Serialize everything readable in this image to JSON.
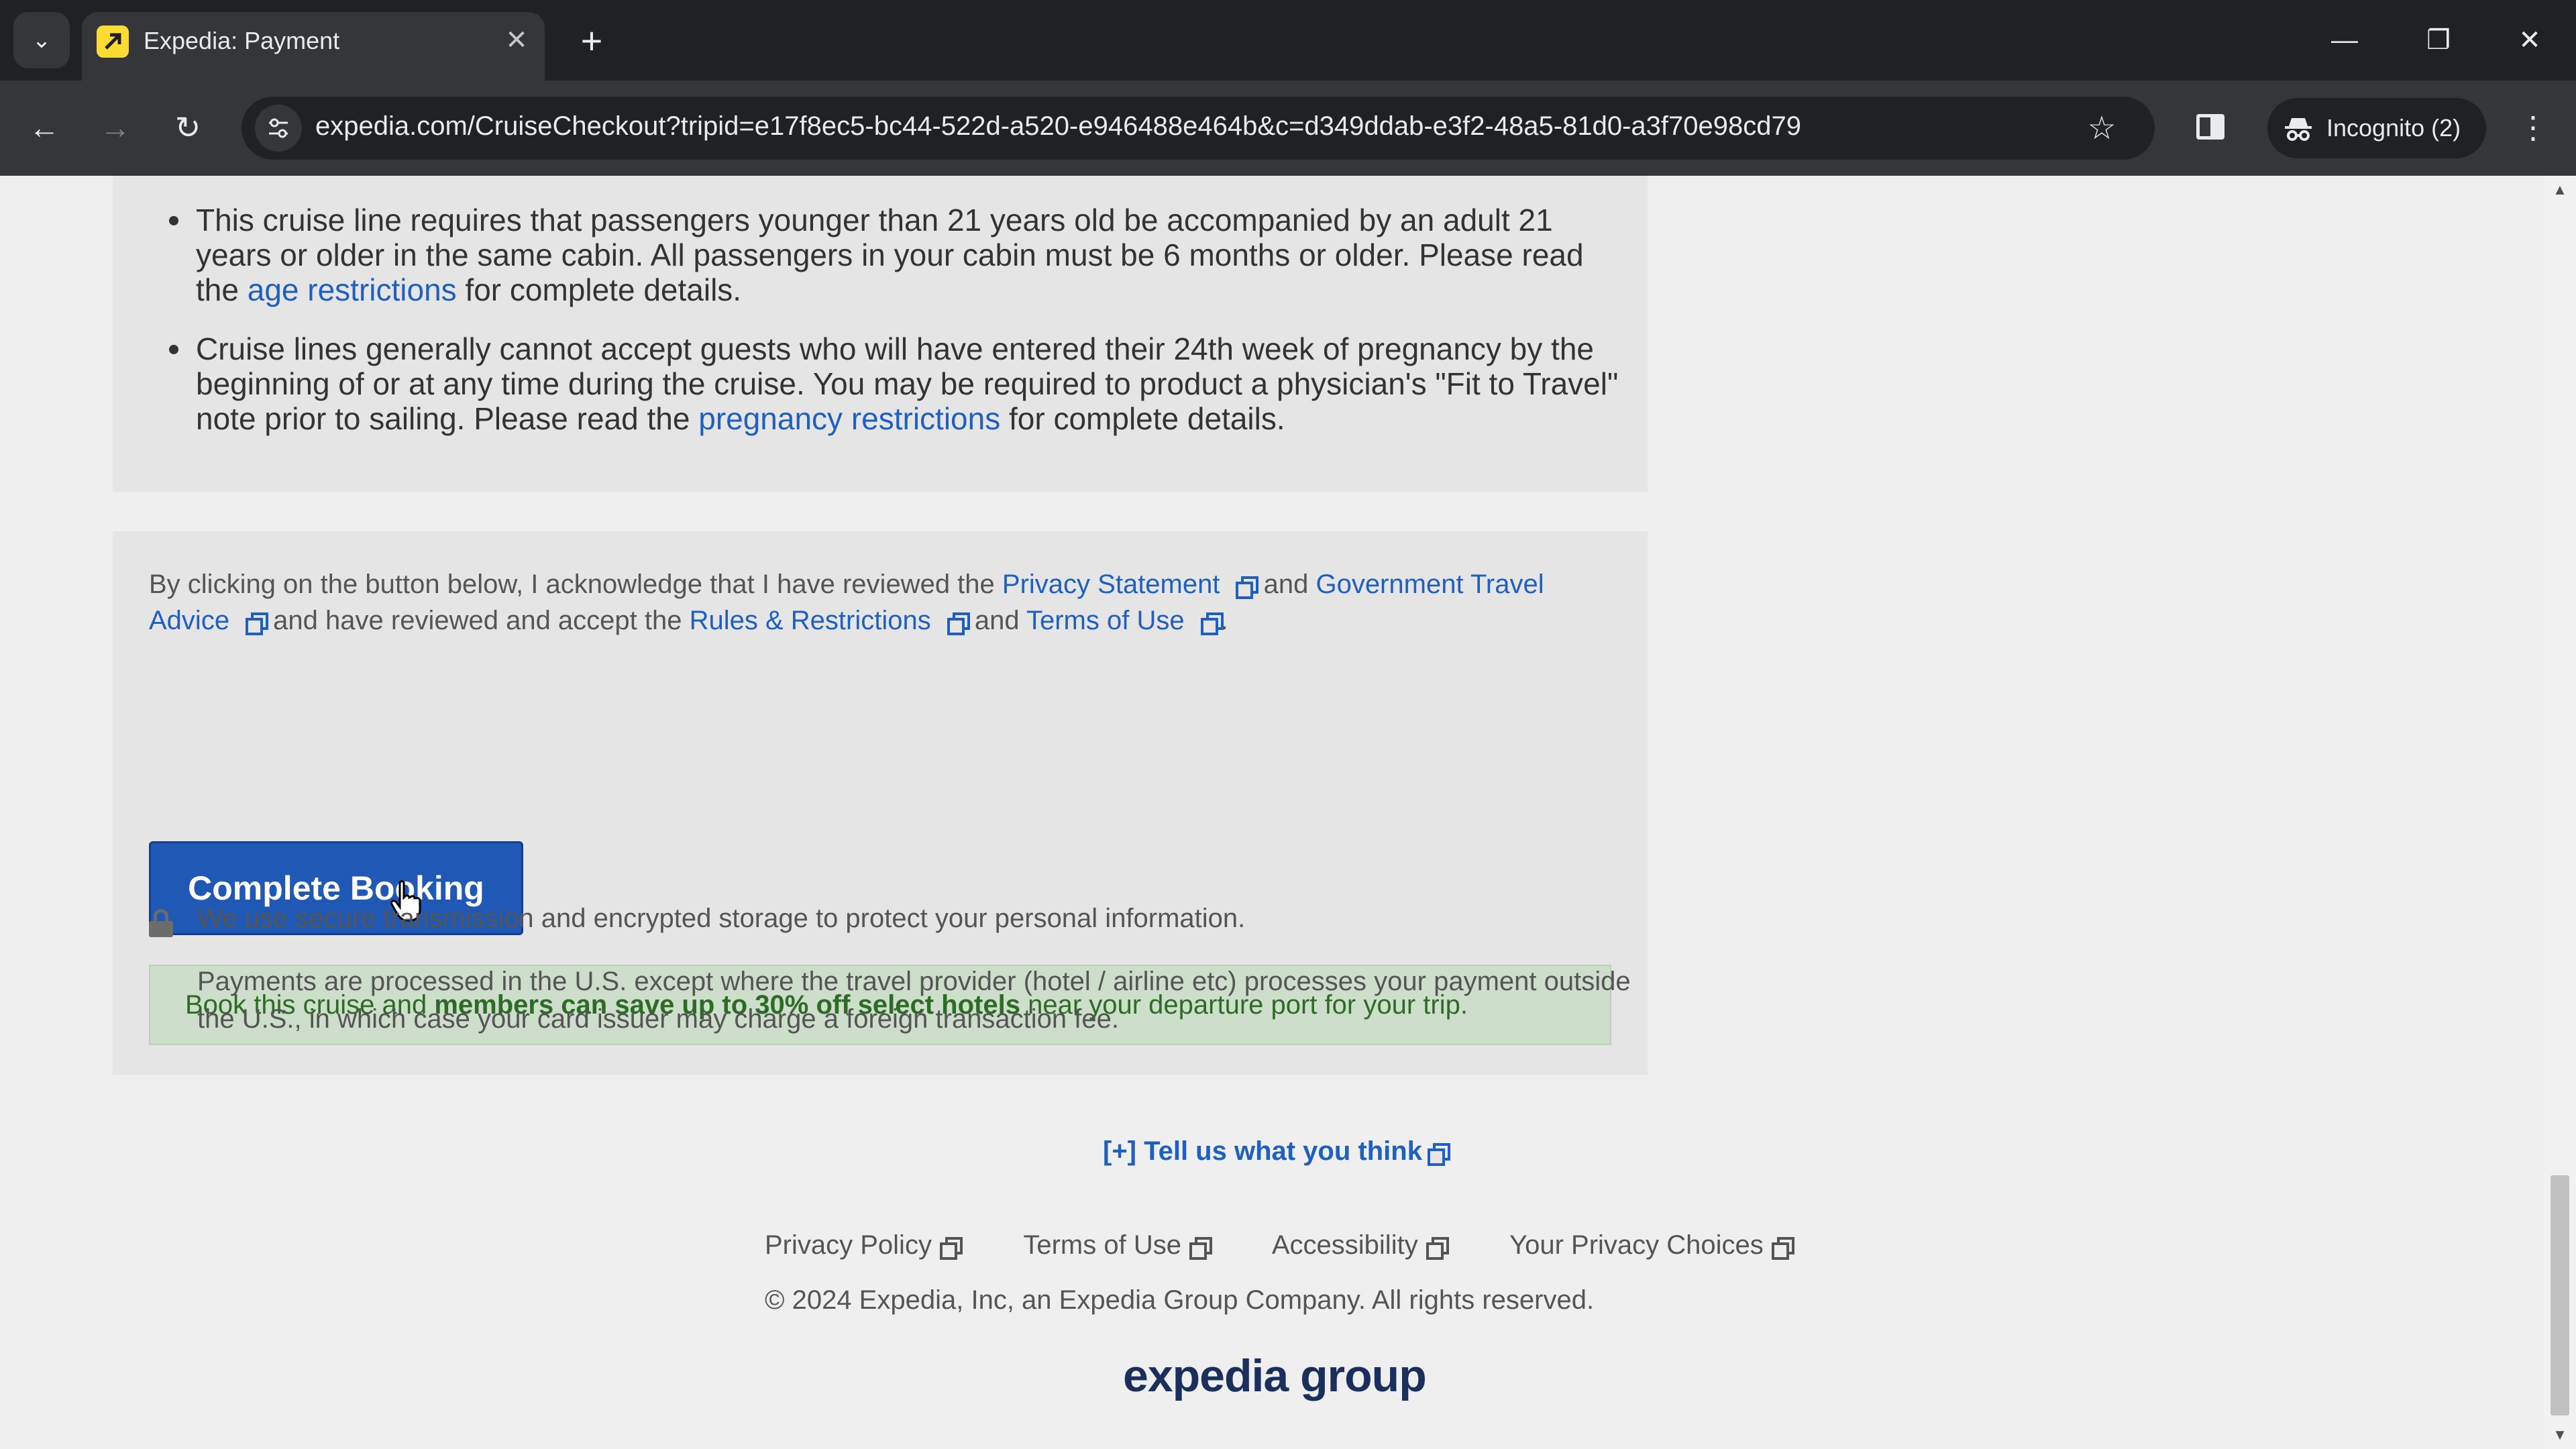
{
  "browser": {
    "tab_title": "Expedia: Payment",
    "url": "expedia.com/CruiseCheckout?tripid=e17f8ec5-bc44-522d-a520-e946488e464b&c=d349ddab-e3f2-48a5-81d0-a3f70e98cd79",
    "incognito_label": "Incognito (2)"
  },
  "restrictions": {
    "age_text_before": "This cruise line requires that passengers younger than 21 years old be accompanied by an adult 21 years or older in the same cabin. All passengers in your cabin must be 6 months or older. Please read the ",
    "age_link": "age restrictions",
    "age_text_after": " for complete details.",
    "pregnancy_text_before": "Cruise lines generally cannot accept guests who will have entered their 24th week of pregnancy by the beginning of or at any time during the cruise. You may be required to product a physician's \"Fit to Travel\" note prior to sailing. Please read the ",
    "pregnancy_link": "pregnancy restrictions",
    "pregnancy_text_after": " for complete details."
  },
  "acknowledgement": {
    "text_1": "By clicking on the button below, I acknowledge that I have reviewed the ",
    "privacy_statement": "Privacy Statement",
    "and_1": " and ",
    "gov_travel_advice": "Government Travel Advice",
    "text_2": " and have reviewed and accept the ",
    "rules_restrictions": "Rules & Restrictions",
    "and_2": " and ",
    "terms_of_use": "Terms of Use",
    "period": "."
  },
  "booking_button": "Complete Booking",
  "promo": {
    "before": "Book this cruise and ",
    "bold": "members can save up to 30% off select hotels",
    "after": " near your departure port for your trip."
  },
  "security": {
    "secure_text": "We use secure transmission and encrypted storage to protect your personal information.",
    "payments_text": "Payments are processed in the U.S. except where the travel provider (hotel / airline etc) processes your payment outside the U.S., in which case your card issuer may charge a foreign transaction fee."
  },
  "footer": {
    "feedback": "[+] Tell us what you think",
    "links": [
      "Privacy Policy",
      "Terms of Use",
      "Accessibility",
      "Your Privacy Choices"
    ],
    "copyright": "© 2024 Expedia, Inc, an Expedia Group Company. All rights reserved.",
    "logo": "expedia group"
  },
  "icons": {
    "tab_list": "chevron-down-icon",
    "favicon": "expedia-favicon-icon",
    "close": "close-icon",
    "new_tab": "plus-icon",
    "back": "back-arrow-icon",
    "forward": "forward-arrow-icon",
    "reload": "reload-icon",
    "site_info": "tune-icon",
    "bookmark": "star-icon",
    "side_panel": "side-panel-icon",
    "incognito": "incognito-icon",
    "menu": "kebab-menu-icon",
    "external": "external-link-icon",
    "lock": "lock-icon"
  },
  "colors": {
    "link": "#1f5fbf",
    "button": "#1f58b5",
    "promo_bg": "#cddfca",
    "promo_text": "#2e6b26"
  }
}
